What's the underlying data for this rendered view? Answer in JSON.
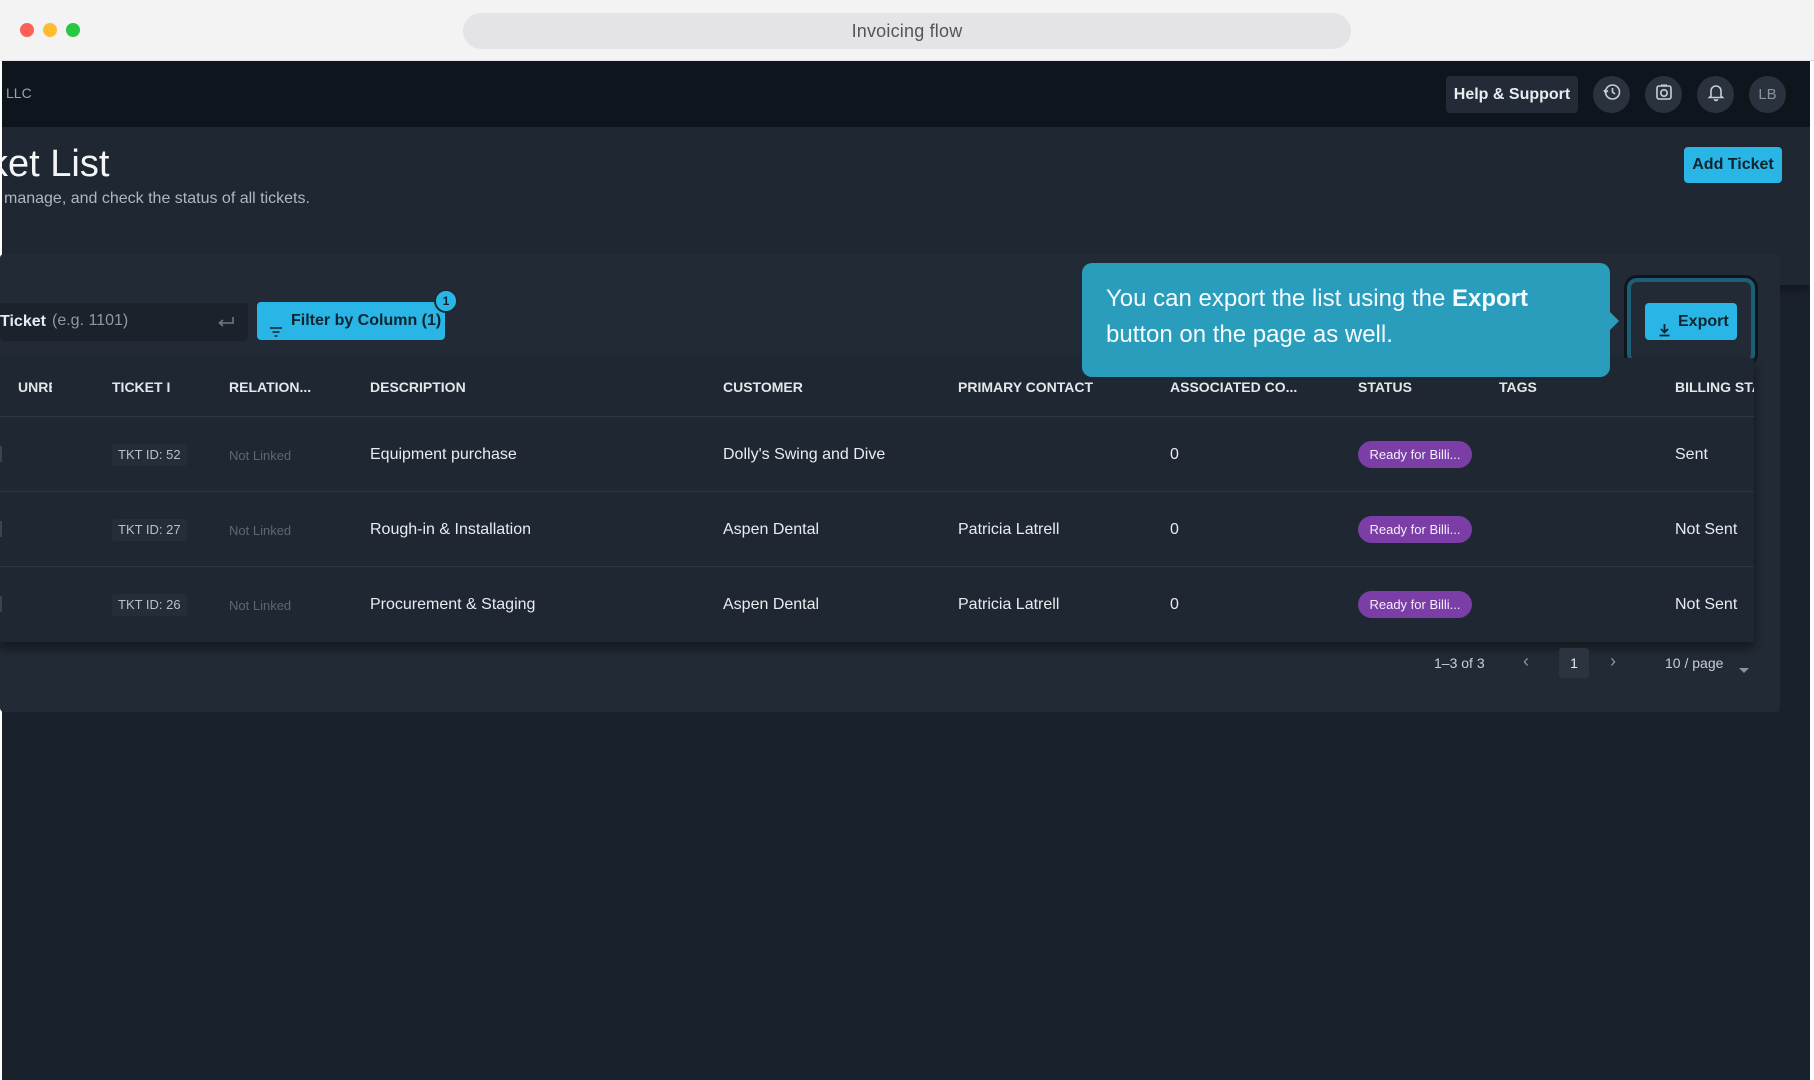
{
  "window": {
    "address": "Invoicing flow"
  },
  "nav": {
    "org": "LLC",
    "help_label": "Help & Support",
    "avatar": "LB",
    "icons": [
      "history-icon",
      "camera-icon",
      "bell-icon"
    ]
  },
  "page": {
    "title": "cket List",
    "subtitle": "manage, and check the status of all tickets.",
    "add_ticket": "Add Ticket"
  },
  "toolbar": {
    "search_label": "Ticket",
    "search_placeholder": "(e.g. 1101)",
    "filter_label": "Filter by Column (1)",
    "filter_badge": "1",
    "export_label": "Export"
  },
  "table": {
    "columns": [
      "UNRE",
      "TICKET I",
      "RELATION...",
      "DESCRIPTION",
      "CUSTOMER",
      "PRIMARY CONTACT",
      "ASSOCIATED CO...",
      "STATUS",
      "TAGS",
      "BILLING STA"
    ],
    "rows": [
      {
        "ticket": "TKT ID: 52",
        "relation": "Not Linked",
        "description": "Equipment purchase",
        "customer": "Dolly's Swing and Dive",
        "contact": "",
        "associated": "0",
        "status": "Ready for Billi...",
        "tags": "",
        "billing": "Sent"
      },
      {
        "ticket": "TKT ID: 27",
        "relation": "Not Linked",
        "description": "Rough-in & Installation",
        "customer": "Aspen Dental",
        "contact": "Patricia Latrell",
        "associated": "0",
        "status": "Ready for Billi...",
        "tags": "",
        "billing": "Not Sent"
      },
      {
        "ticket": "TKT ID: 26",
        "relation": "Not Linked",
        "description": "Procurement & Staging",
        "customer": "Aspen Dental",
        "contact": "Patricia Latrell",
        "associated": "0",
        "status": "Ready for Billi...",
        "tags": "",
        "billing": "Not Sent"
      }
    ]
  },
  "pagination": {
    "range": "1–3 of 3",
    "current_page": "1",
    "page_size": "10 / page"
  },
  "tooltip": {
    "text_before": "You can export the list using the ",
    "text_bold": "Export",
    "text_after": " button on the page as well."
  },
  "colors": {
    "accent": "#29b6e6",
    "status_purple": "#7a3ea6",
    "tooltip": "#2a9dbd",
    "background": "#19212c"
  }
}
